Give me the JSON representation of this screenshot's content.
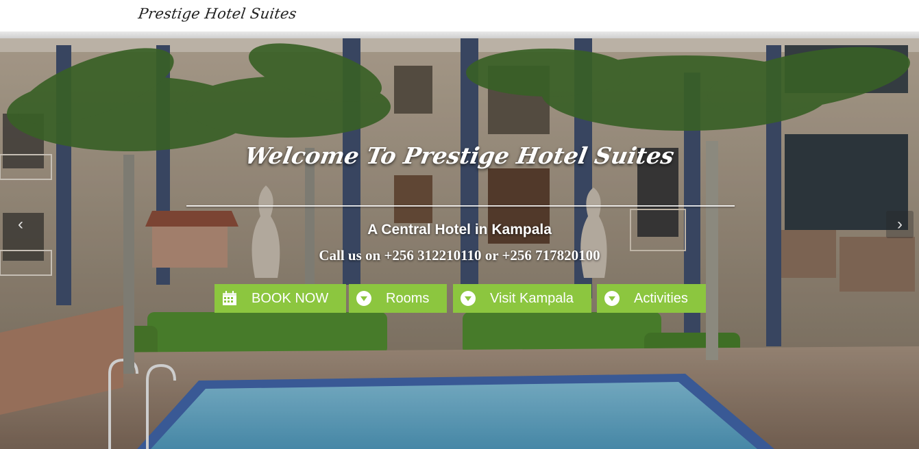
{
  "header": {
    "logo_text": "Prestige Hotel Suites"
  },
  "hero": {
    "headline": "Welcome To Prestige Hotel Suites",
    "subtitle": "A Central Hotel in Kampala",
    "phone_line": "Call us on +256 312210110 or +256 717820100",
    "prev_glyph": "‹",
    "next_glyph": "›"
  },
  "actions": [
    {
      "label": "BOOK NOW",
      "icon": "calendar-icon"
    },
    {
      "label": "Rooms",
      "icon": "chevron-down-circle-icon"
    },
    {
      "label": "Visit Kampala",
      "icon": "chevron-down-circle-icon"
    },
    {
      "label": "Activities",
      "icon": "chevron-down-circle-icon"
    }
  ],
  "colors": {
    "button_green": "#8cc63f",
    "text": "#ffffff"
  }
}
